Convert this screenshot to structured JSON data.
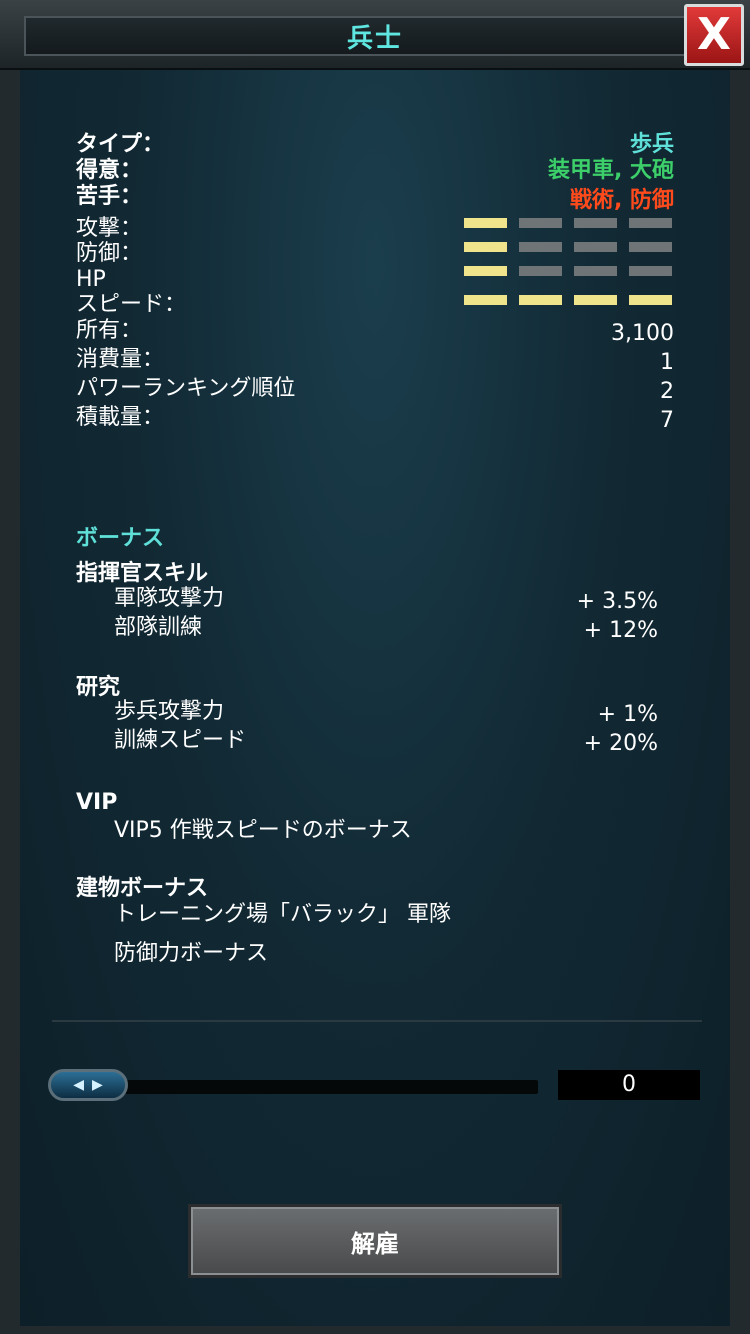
{
  "header": {
    "title": "兵士",
    "close_label": "X"
  },
  "info": {
    "type_label": "タイプ：",
    "type_value": "歩兵",
    "strong_label": "得意：",
    "strong_value": "装甲車, 大砲",
    "weak_label": "苦手：",
    "weak_value": "戦術, 防御",
    "stats": [
      {
        "label": "攻撃：",
        "level": 1,
        "max": 4
      },
      {
        "label": "防御：",
        "level": 1,
        "max": 4
      },
      {
        "label": "HP",
        "level": 1,
        "max": 4
      },
      {
        "label": "スピード：",
        "level": 4,
        "max": 4
      }
    ],
    "owned_label": "所有：",
    "owned_value": "3,100",
    "upkeep_label": "消費量：",
    "upkeep_value": "1",
    "power_label": "パワーランキング順位",
    "power_value": "2",
    "load_label": "積載量：",
    "load_value": "7"
  },
  "bonus": {
    "heading": "ボーナス",
    "commander": {
      "heading": "指揮官スキル",
      "items": [
        {
          "label": "軍隊攻撃力",
          "value": "+ 3.5%"
        },
        {
          "label": "部隊訓練",
          "value": "+ 12%"
        }
      ]
    },
    "research": {
      "heading": "研究",
      "items": [
        {
          "label": "歩兵攻撃力",
          "value": "+ 1%"
        },
        {
          "label": "訓練スピード",
          "value": "+ 20%"
        }
      ]
    },
    "vip": {
      "heading": "VIP",
      "text": "VIP5 作戦スピードのボーナス"
    },
    "building": {
      "heading": "建物ボーナス",
      "line1": "トレーニング場「バラック」 軍隊",
      "line2": "防御力ボーナス"
    }
  },
  "slider": {
    "value": "0",
    "knob_left": "◀",
    "knob_right": "▶"
  },
  "actions": {
    "dismiss_label": "解雇"
  },
  "colors": {
    "accent": "#5fe0d8",
    "strong": "#3ccf6a",
    "weak": "#ff4a1c",
    "bar_on": "#efe38c",
    "bar_off": "#6f7476"
  }
}
